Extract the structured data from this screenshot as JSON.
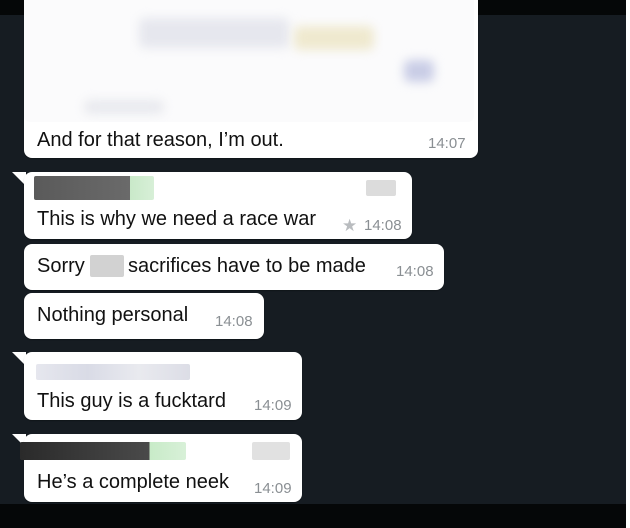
{
  "colors": {
    "background": "#161c22",
    "bubble": "#ffffff",
    "text": "#111111",
    "timestamp": "#8a8f93"
  },
  "messages": [
    {
      "text": "And for that reason, I’m out.",
      "time": "14:07"
    },
    {
      "text": "This is why we need a race war",
      "time": "14:08",
      "starred": true,
      "star_icon": "★"
    },
    {
      "text_a": "Sorry",
      "text_b": "sacrifices have to be made",
      "time": "14:08"
    },
    {
      "text": "Nothing personal",
      "time": "14:08"
    },
    {
      "text": "This guy is a fucktard",
      "time": "14:09"
    },
    {
      "text": "He’s a complete neek",
      "time": "14:09"
    }
  ]
}
